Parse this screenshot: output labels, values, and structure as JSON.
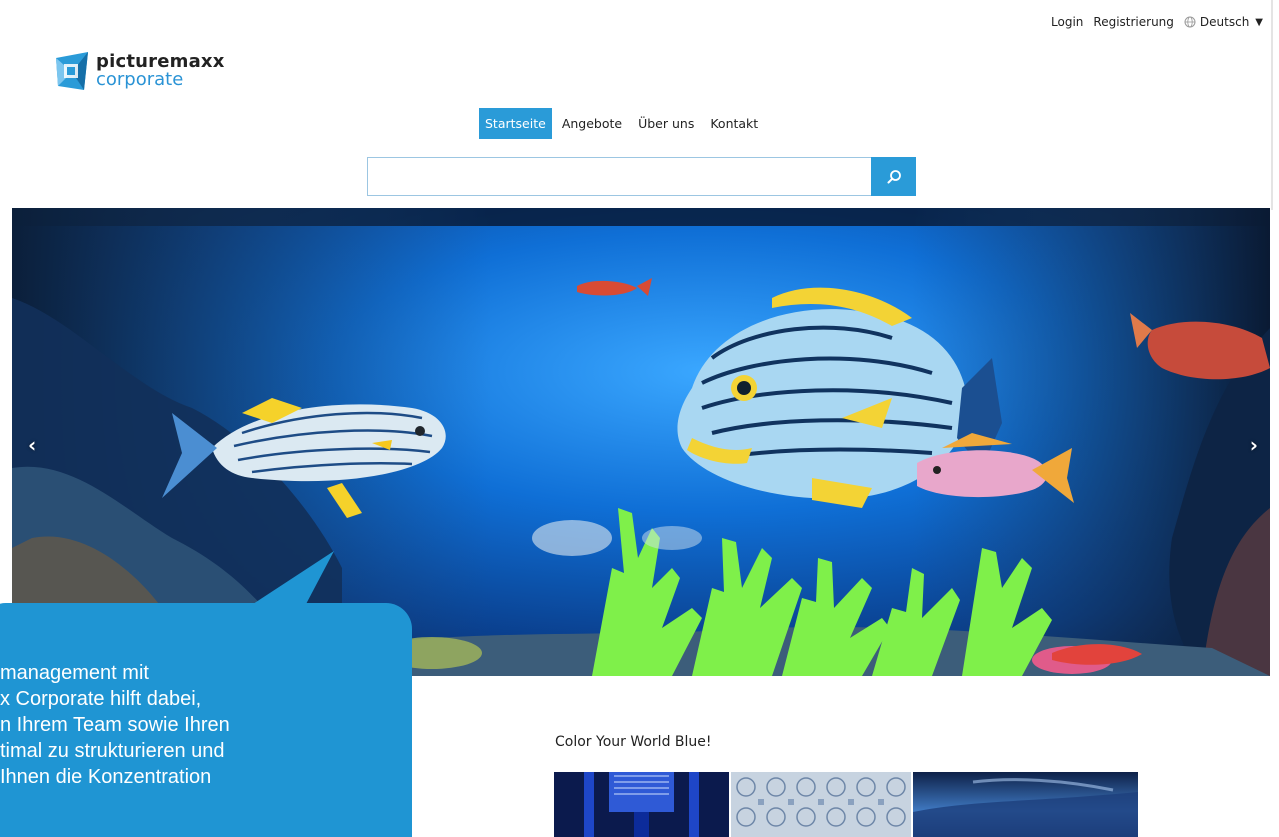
{
  "topbar": {
    "login": "Login",
    "register": "Registrierung",
    "language": "Deutsch"
  },
  "logo": {
    "line1": "picturemaxx",
    "line2": "corporate"
  },
  "nav": {
    "items": [
      "Startseite",
      "Angebote",
      "Über uns",
      "Kontakt"
    ],
    "active": "Startseite"
  },
  "search": {
    "value": "",
    "icon": "search-icon"
  },
  "hero": {
    "prev_icon": "chevron-left-icon",
    "next_icon": "chevron-right-icon"
  },
  "section": {
    "title": "Color Your World Blue!"
  },
  "bubble": {
    "lines": [
      "management mit",
      "x Corporate hilft dabei,",
      "n Ihrem Team sowie Ihren",
      "timal zu strukturieren und",
      "Ihnen die Konzentration"
    ]
  },
  "colors": {
    "accent": "#2a9bd8",
    "bubble": "#1f95d3"
  }
}
